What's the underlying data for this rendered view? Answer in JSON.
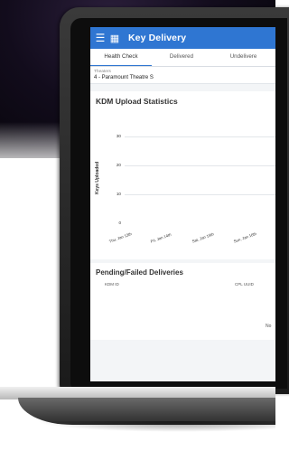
{
  "app": {
    "title": "Key Delivery",
    "menu_icon": "hamburger-icon",
    "apps_icon": "grid-icon"
  },
  "tabs": [
    {
      "label": "Health Check",
      "active": true
    },
    {
      "label": "Delivered",
      "active": false
    },
    {
      "label": "Undelivere",
      "active": false
    }
  ],
  "theater_selector": {
    "label": "Theaters",
    "value": "4 - Paramount Theatre S"
  },
  "kdm_stats": {
    "title": "KDM Upload Statistics"
  },
  "chart_data": {
    "type": "line",
    "title": "KDM Upload Statistics",
    "ylabel": "Keys Uploaded",
    "xlabel": "",
    "categories": [
      "Thu, Jan 13th",
      "Fri, Jan 14th",
      "Sat, Jan 15th",
      "Sun, Jan 16th"
    ],
    "y_ticks": [
      "30",
      "20",
      "10",
      "0"
    ],
    "ylim": [
      0,
      30
    ],
    "grid": true,
    "series": []
  },
  "pending": {
    "title": "Pending/Failed Deliveries",
    "columns": [
      "KDM ID",
      "CPL UUID"
    ],
    "empty_text": "No"
  },
  "colors": {
    "accent": "#2f76d2"
  }
}
